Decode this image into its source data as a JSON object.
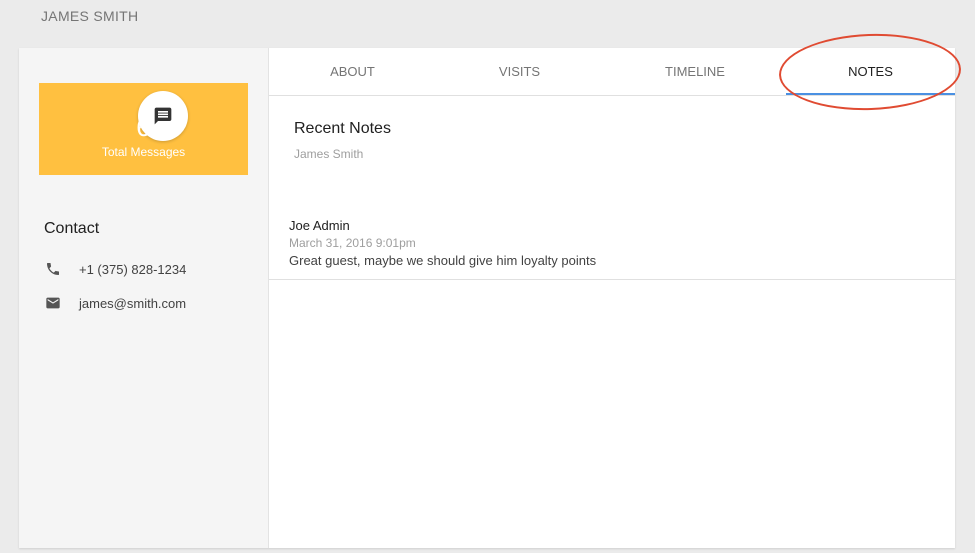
{
  "page": {
    "heading": "JAMES SMITH"
  },
  "messages": {
    "count": "6",
    "label": "Total Messages",
    "icon": "message-icon"
  },
  "contact": {
    "title": "Contact",
    "phone": {
      "icon": "phone-icon",
      "value": "+1 (375) 828-1234"
    },
    "email": {
      "icon": "mail-icon",
      "value": "james@smith.com"
    }
  },
  "tabs": [
    {
      "label": "ABOUT"
    },
    {
      "label": "VISITS"
    },
    {
      "label": "TIMELINE"
    },
    {
      "label": "NOTES",
      "active": true
    }
  ],
  "notes_section": {
    "title": "Recent Notes",
    "subtitle": "James Smith"
  },
  "notes": [
    {
      "author": "Joe Admin",
      "date": "March 31, 2016 9:01pm",
      "text": "Great guest, maybe we should give him loyalty points"
    }
  ],
  "colors": {
    "accent_card": "#ffc040",
    "tab_indicator": "#4a90e2",
    "annotation": "#e04b32"
  }
}
